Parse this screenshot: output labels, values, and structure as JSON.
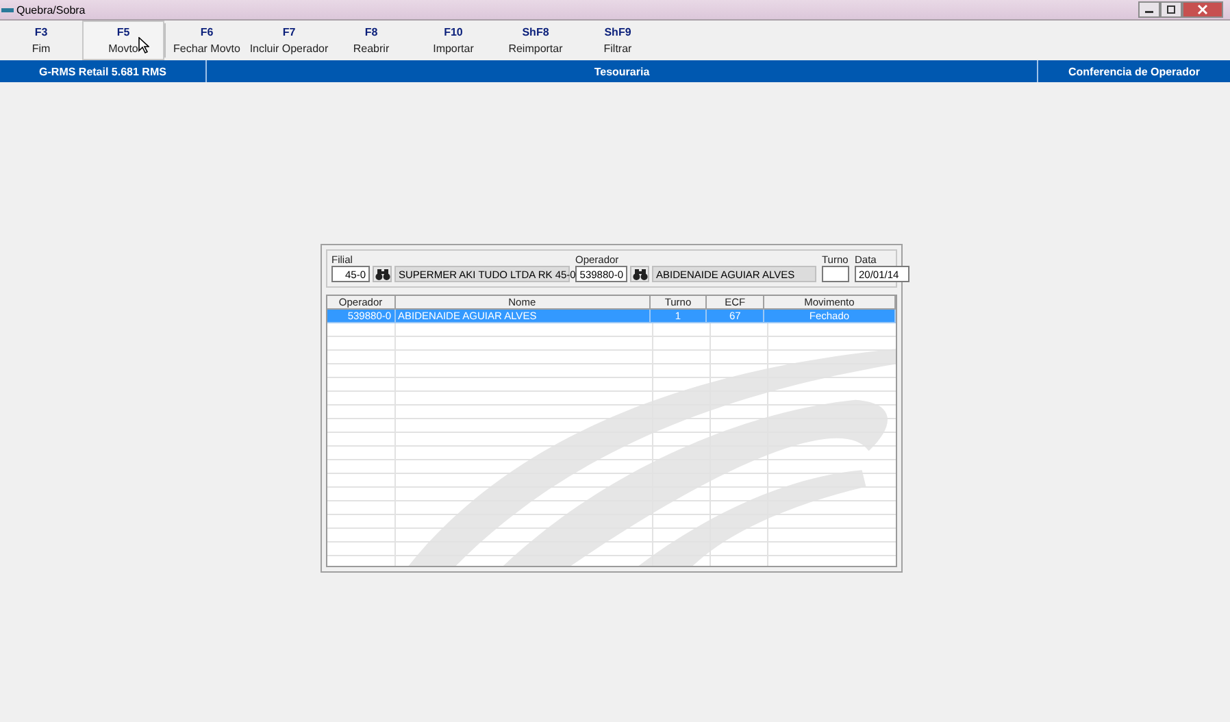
{
  "window": {
    "title": "Quebra/Sobra"
  },
  "toolbar": [
    {
      "key": "F3",
      "label": "Fim",
      "hovered": false
    },
    {
      "key": "F5",
      "label": "Movto",
      "hovered": true
    },
    {
      "key": "F6",
      "label": "Fechar Movto",
      "hovered": false
    },
    {
      "key": "F7",
      "label": "Incluir Operador",
      "hovered": false
    },
    {
      "key": "F8",
      "label": "Reabrir",
      "hovered": false
    },
    {
      "key": "F10",
      "label": "Importar",
      "hovered": false
    },
    {
      "key": "ShF8",
      "label": "Reimportar",
      "hovered": false
    },
    {
      "key": "ShF9",
      "label": "Filtrar",
      "hovered": false
    }
  ],
  "status_bar": {
    "left": "G-RMS Retail 5.681 RMS",
    "center": "Tesouraria",
    "right": "Conferencia de Operador"
  },
  "filters": {
    "filial": {
      "label": "Filial",
      "value": "45-0",
      "description": "SUPERMER AKI TUDO LTDA RK 45-0"
    },
    "operador": {
      "label": "Operador",
      "value": "539880-0",
      "description": "ABIDENAIDE AGUIAR ALVES"
    },
    "turno": {
      "label": "Turno"
    },
    "data": {
      "label": "Data",
      "value": "20/01/14"
    }
  },
  "table": {
    "columns": [
      "Operador",
      "Nome",
      "Turno",
      "ECF",
      "Movimento"
    ],
    "rows": [
      {
        "cells": [
          "539880-0",
          "ABIDENAIDE AGUIAR ALVES",
          "1",
          "67",
          "Fechado"
        ],
        "selected": true
      }
    ]
  }
}
